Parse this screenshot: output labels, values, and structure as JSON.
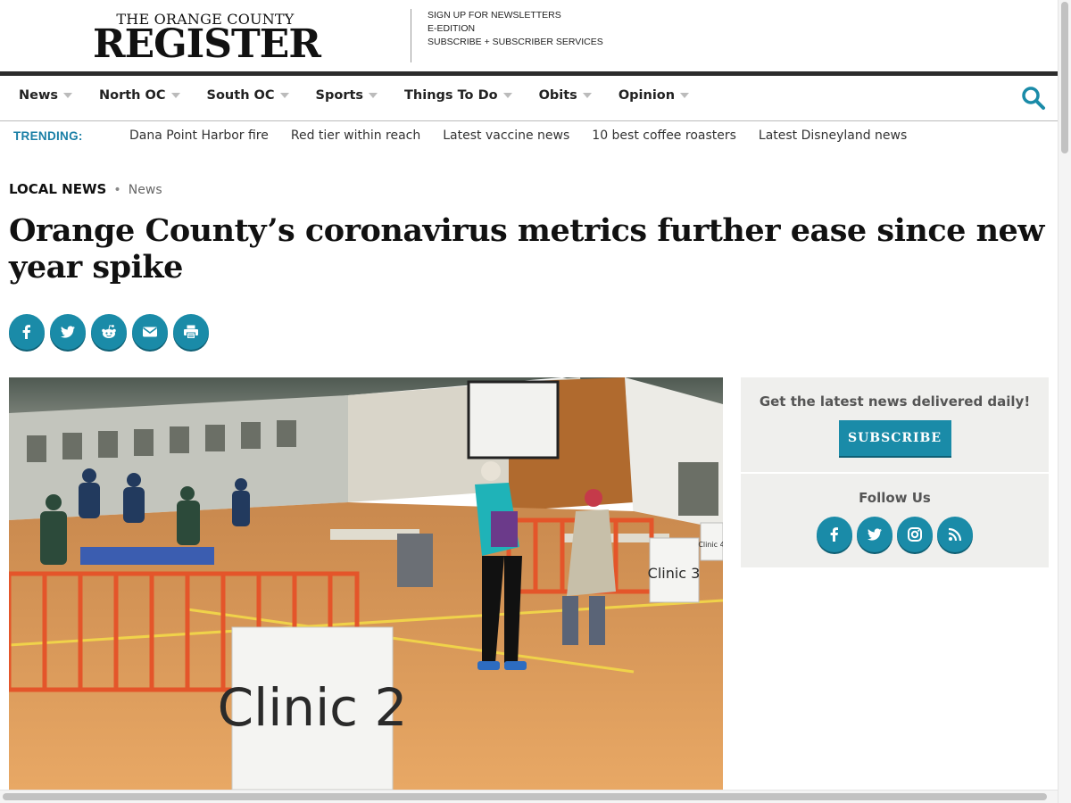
{
  "header": {
    "logo_top": "THE ORANGE COUNTY",
    "logo_main": "REGISTER",
    "links": [
      "SIGN UP FOR NEWSLETTERS",
      "E-EDITION",
      "SUBSCRIBE + SUBSCRIBER SERVICES"
    ]
  },
  "nav": {
    "items": [
      {
        "label": "News"
      },
      {
        "label": "North OC"
      },
      {
        "label": "South OC"
      },
      {
        "label": "Sports"
      },
      {
        "label": "Things To Do"
      },
      {
        "label": "Obits"
      },
      {
        "label": "Opinion"
      }
    ],
    "search_icon": "search-icon"
  },
  "trending": {
    "label": "TRENDING:",
    "items": [
      "Dana Point Harbor fire",
      "Red tier within reach",
      "Latest vaccine news",
      "10 best coffee roasters",
      "Latest Disneyland news"
    ]
  },
  "article": {
    "section": "LOCAL NEWS",
    "separator": "•",
    "subsection": "News",
    "headline": "Orange County’s coronavirus metrics further ease since new year spike",
    "share_icons": [
      "facebook-icon",
      "twitter-icon",
      "reddit-icon",
      "email-icon",
      "print-icon"
    ],
    "photo_signs": {
      "front": "Clinic 2",
      "right": "Clinic 3",
      "far": "Clinic 4"
    }
  },
  "sidebar": {
    "newsletter_title": "Get the latest news delivered daily!",
    "subscribe_label": "SUBSCRIBE",
    "follow_title": "Follow Us",
    "follow_icons": [
      "facebook-icon",
      "twitter-icon",
      "instagram-icon",
      "rss-icon"
    ]
  },
  "colors": {
    "accent": "#1a8ba8",
    "trending_label": "#1a7fa6",
    "sidebar_bg": "#efefed",
    "nav_border": "#2c2c2c"
  }
}
